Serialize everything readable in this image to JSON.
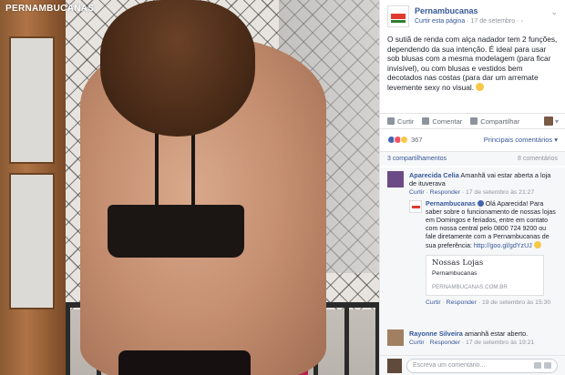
{
  "photo": {
    "watermark": "PERNAMBUCANAS"
  },
  "post": {
    "page_name": "Pernambucanas",
    "like_page": "Curtir esta página",
    "separator": "·",
    "date": "17 de setembro",
    "globe": "◦",
    "text": "O sutiã de renda com alça nadador tem 2 funções, dependendo da sua intenção. É ideal para usar sob blusas com a mesma modelagem (para ficar invisível), ou com blusas e vestidos bem decotados nas costas (para dar um arremate levemente sexy no visual."
  },
  "actions": {
    "like": "Curtir",
    "comment": "Comentar",
    "share": "Compartilhar"
  },
  "reactions": {
    "count": "367",
    "sort": "Principais comentários ▾"
  },
  "meta": {
    "shares": "3 compartilhamentos",
    "comments": "8 comentários"
  },
  "comments": [
    {
      "name": "Aparecida Celia",
      "text": "Amanhã vai estar aberta a loja de ituverava",
      "like": "Curtir",
      "reply": "Responder",
      "time": "17 de setembro às 21:27"
    },
    {
      "name": "Rayonne Silveira",
      "text": "amanhã estar aberto.",
      "like": "Curtir",
      "reply": "Responder",
      "time": "17 de setembro às 19:21"
    }
  ],
  "reply": {
    "name": "Pernambucanas",
    "text": "Olá Aparecida! Para saber sobre o funcionamento de nossas lojas em Domingos e feriados, entre em contato com nossa central pelo 0800 724 9200 ou fale diretamente com a Pernambucanas de sua preferência:",
    "link": "http://goo.gl/gdYzUJ",
    "card_title": "Nossas Lojas",
    "card_desc": "Pernambucanas",
    "card_domain": "PERNAMBUCANAS.COM.BR",
    "like": "Curtir",
    "reply": "Responder",
    "time": "19 de setembro às 15:30"
  },
  "composer": {
    "placeholder": "Escreva um comentário..."
  }
}
